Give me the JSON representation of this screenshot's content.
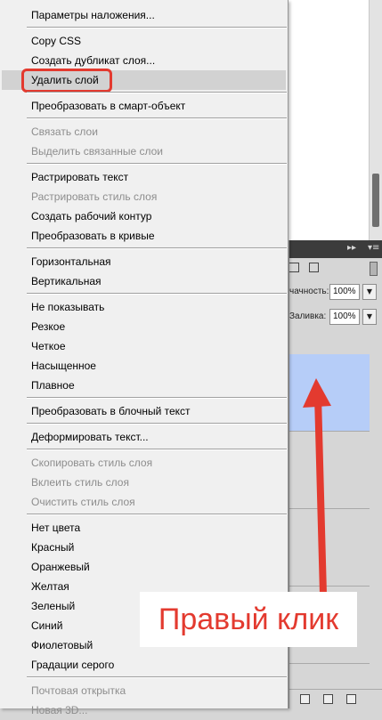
{
  "context_menu": {
    "items": [
      {
        "label": "Параметры наложения...",
        "state": "normal"
      },
      {
        "separator": true
      },
      {
        "label": "Copy CSS",
        "state": "normal"
      },
      {
        "label": "Создать дубликат слоя...",
        "state": "normal"
      },
      {
        "label": "Удалить слой",
        "state": "highlighted"
      },
      {
        "separator": true
      },
      {
        "label": "Преобразовать в смарт-объект",
        "state": "normal"
      },
      {
        "separator": true
      },
      {
        "label": "Связать слои",
        "state": "disabled"
      },
      {
        "label": "Выделить связанные слои",
        "state": "disabled"
      },
      {
        "separator": true
      },
      {
        "label": "Растрировать текст",
        "state": "normal"
      },
      {
        "label": "Растрировать стиль слоя",
        "state": "disabled"
      },
      {
        "label": "Создать рабочий контур",
        "state": "normal"
      },
      {
        "label": "Преобразовать в кривые",
        "state": "normal"
      },
      {
        "separator": true
      },
      {
        "label": "Горизонтальная",
        "state": "normal"
      },
      {
        "label": "Вертикальная",
        "state": "normal"
      },
      {
        "separator": true
      },
      {
        "label": "Не показывать",
        "state": "normal"
      },
      {
        "label": "Резкое",
        "state": "normal"
      },
      {
        "label": "Четкое",
        "state": "normal"
      },
      {
        "label": "Насыщенное",
        "state": "normal"
      },
      {
        "label": "Плавное",
        "state": "normal"
      },
      {
        "separator": true
      },
      {
        "label": "Преобразовать в блочный текст",
        "state": "normal"
      },
      {
        "separator": true
      },
      {
        "label": "Деформировать текст...",
        "state": "normal"
      },
      {
        "separator": true
      },
      {
        "label": "Скопировать стиль слоя",
        "state": "disabled"
      },
      {
        "label": "Вклеить стиль слоя",
        "state": "disabled"
      },
      {
        "label": "Очистить стиль слоя",
        "state": "disabled"
      },
      {
        "separator": true
      },
      {
        "label": "Нет цвета",
        "state": "normal"
      },
      {
        "label": "Красный",
        "state": "normal"
      },
      {
        "label": "Оранжевый",
        "state": "normal"
      },
      {
        "label": "Желтая",
        "state": "normal"
      },
      {
        "label": "Зеленый",
        "state": "normal"
      },
      {
        "label": "Синий",
        "state": "normal"
      },
      {
        "label": "Фиолетовый",
        "state": "normal"
      },
      {
        "label": "Градации серого",
        "state": "normal"
      },
      {
        "separator": true
      },
      {
        "label": "Почтовая открытка",
        "state": "disabled"
      },
      {
        "label": "Новая 3D...",
        "state": "disabled"
      }
    ]
  },
  "layers_panel": {
    "opacity_label": "чачность:",
    "opacity_value": "100%",
    "fill_label": "Заливка:",
    "fill_value": "100%"
  },
  "annotation": {
    "callout_text": "Правый клик",
    "color": "#e33a2f"
  }
}
